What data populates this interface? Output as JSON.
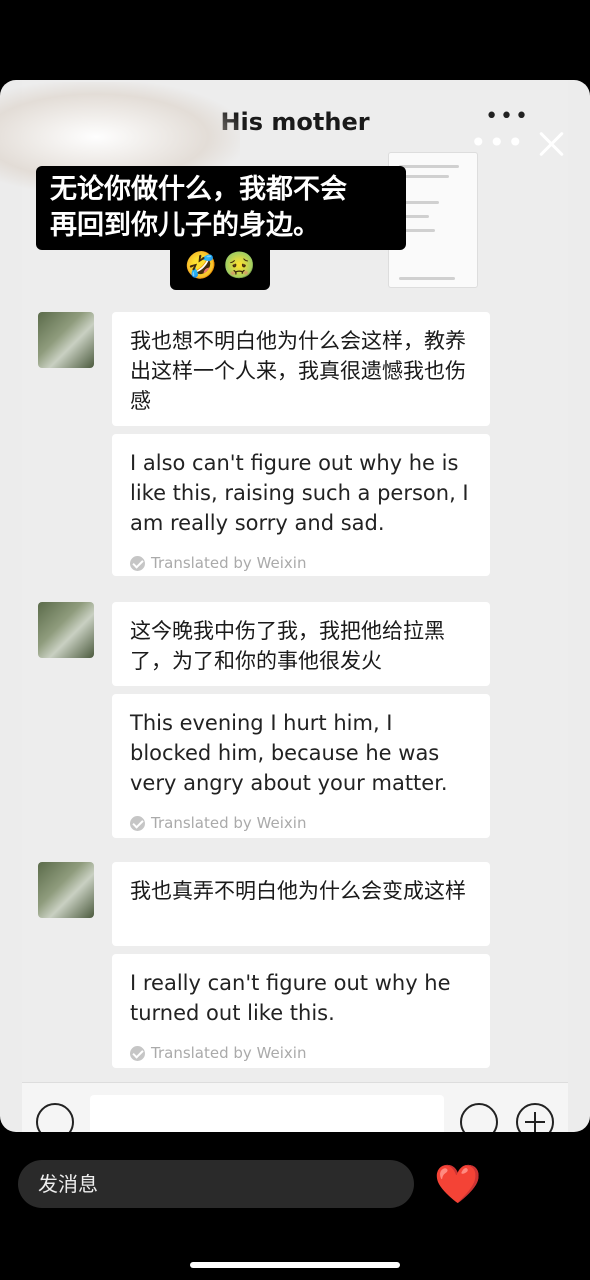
{
  "story": {
    "more_icon": "more-horizontal-icon",
    "close_icon": "close-icon",
    "caption_lines": [
      "无论你做什么，我都不会",
      "再回到你儿子的身边。"
    ],
    "caption_emojis": [
      "🤣",
      "🤢"
    ],
    "reply_placeholder": "发消息",
    "reactions": [
      "❤️",
      "😆",
      "😮"
    ]
  },
  "chat": {
    "title": "His mother",
    "more_label": "•••",
    "messages": [
      {
        "original": "我也想不明白他为什么会这样，教养出这样一个人来，我真很遗憾我也伤感",
        "translation": "I also can't figure out why he is like this, raising such a person, I am really sorry and sad.",
        "translated_by": "Translated by Weixin"
      },
      {
        "original": "这今晚我中伤了我，我把他给拉黑了，为了和你的事他很发火",
        "translation": "This evening I hurt him, I blocked him, because he was very angry about your matter.",
        "translated_by": "Translated by Weixin"
      },
      {
        "original": "我也真弄不明白他为什么会变成这样",
        "translation": "I really can't figure out why he turned out like this.",
        "translated_by": "Translated by Weixin"
      }
    ]
  },
  "input_bar": {
    "voice_icon": "voice-icon",
    "emoji_icon": "emoji-icon",
    "plus_icon": "plus-icon"
  }
}
